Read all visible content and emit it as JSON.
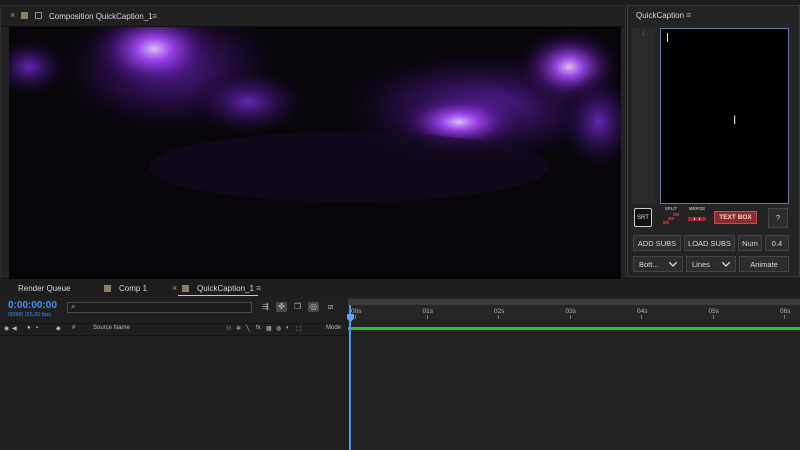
{
  "composition": {
    "close": "×",
    "tab_label": "Composition QuickCaption_1",
    "menu": "≡"
  },
  "quickcaption": {
    "title": "QuickCaption",
    "menu": "≡",
    "line_number": "1",
    "srt_label": "SRT",
    "split_label": "SPLIT",
    "merge_label": "MERGE",
    "textbox_label": "TEXT BOX",
    "help_label": "?",
    "add_subs": "ADD SUBS",
    "load_subs": "LOAD SUBS",
    "num_label": "Num",
    "num_value": "0.4",
    "position_select": "Bott...",
    "mode_select": "Lines",
    "animate": "Animate"
  },
  "timeline_tabs": [
    {
      "label": "Render Queue"
    },
    {
      "label": "Comp 1"
    },
    {
      "label": "QuickCaption_1",
      "close": "×",
      "menu": "≡"
    }
  ],
  "timeline": {
    "timecode": "0:00:00:00",
    "fps": "00000 (25.00 fps)",
    "search_icon": "search-icon",
    "columns": {
      "hash": "#",
      "source_name": "Source Name",
      "mode": "Mode"
    },
    "ruler_labels": [
      "00s",
      "01s",
      "02s",
      "03s",
      "04s",
      "05s",
      "06s"
    ],
    "accent_color": "#3e8ef5",
    "work_area_color": "#1ec92e"
  }
}
